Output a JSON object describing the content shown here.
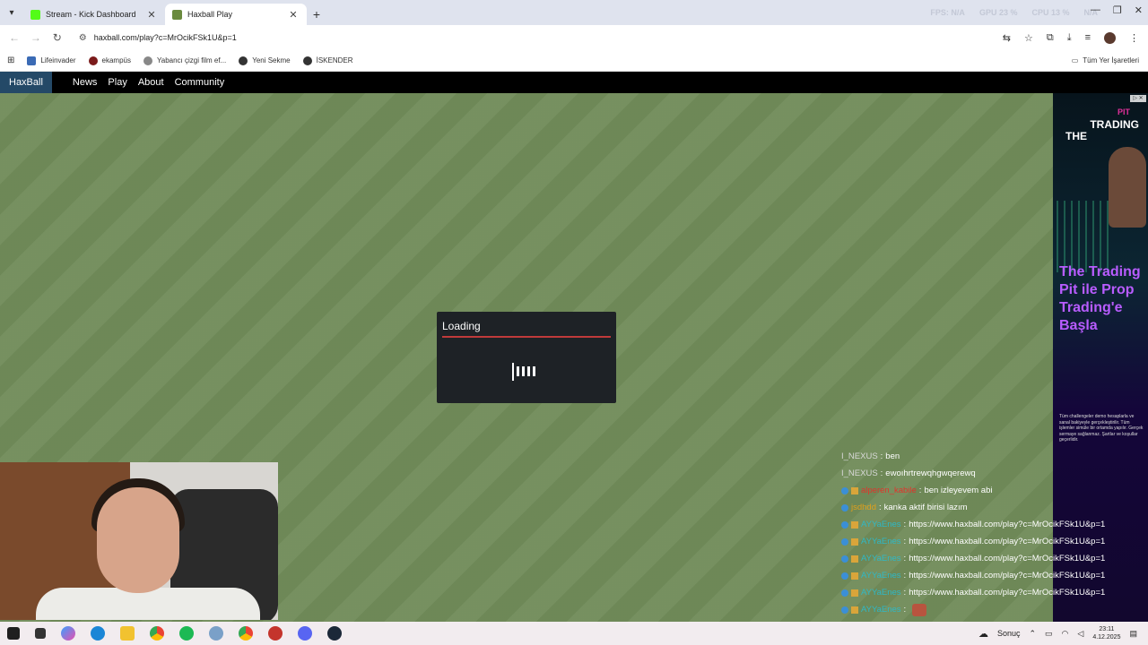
{
  "browser": {
    "tabs": [
      {
        "title": "Stream - Kick Dashboard",
        "fav_color": "#53fc18"
      },
      {
        "title": "Haxball Play",
        "fav_color": "#6a8a3e"
      }
    ],
    "url": "haxball.com/play?c=MrOcikFSk1U&p=1",
    "stats": [
      "FPS: N/A",
      "GPU 23 %",
      "CPU 13 %",
      "N/A"
    ],
    "bookmarks": [
      "Lifeinvader",
      "ekampüs",
      "Yabancı çizgi film ef...",
      "Yeni Sekme",
      "İSKENDER"
    ],
    "all_bookmarks": "Tüm Yer İşaretleri"
  },
  "haxball": {
    "logo": "HaxBall",
    "nav": [
      "News",
      "Play",
      "About",
      "Community"
    ],
    "loading_title": "Loading"
  },
  "ad": {
    "pit": "PIT",
    "trading": "TRADING",
    "the": "THE",
    "headline": "The Trading Pit ile Prop Trading'e Başla",
    "fineprint": "Tüm challengeler demo hesaplarla ve sanal bakiyeyle gerçekleştirilir. Tüm işlemler simüle bir ortamda yapılır. Gerçek sermaye sağlanmaz. Şartlar ve koşullar geçerlidir."
  },
  "chat": [
    {
      "user": "I_NEXUS",
      "user_color": "#d8d8d8",
      "msg": "ben",
      "badges": 0
    },
    {
      "user": "I_NEXUS",
      "user_color": "#d8d8d8",
      "msg": "ewoıhrtrewqhgwqerewq",
      "badges": 0
    },
    {
      "user": "alperen_kabile",
      "user_color": "#e0342c",
      "msg": "ben izleyevem abi",
      "badges": 2
    },
    {
      "user": "jsdhdd",
      "user_color": "#e0a01c",
      "msg": "kanka aktif birisi lazım",
      "badges": 1
    },
    {
      "user": "AYYaEnes",
      "user_color": "#2fb8c6",
      "msg": "https://www.haxball.com/play?c=MrOcikFSk1U&p=1",
      "badges": 2
    },
    {
      "user": "AYYaEnes",
      "user_color": "#2fb8c6",
      "msg": "https://www.haxball.com/play?c=MrOcikFSk1U&p=1",
      "badges": 2
    },
    {
      "user": "AYYaEnes",
      "user_color": "#2fb8c6",
      "msg": "https://www.haxball.com/play?c=MrOcikFSk1U&p=1",
      "badges": 2
    },
    {
      "user": "AYYaEnes",
      "user_color": "#2fb8c6",
      "msg": "https://www.haxball.com/play?c=MrOcikFSk1U&p=1",
      "badges": 2
    },
    {
      "user": "AYYaEnes",
      "user_color": "#2fb8c6",
      "msg": "https://www.haxball.com/play?c=MrOcikFSk1U&p=1",
      "badges": 2
    },
    {
      "user": "AYYaEnes",
      "user_color": "#2fb8c6",
      "msg": "",
      "badges": 2
    }
  ],
  "taskbar": {
    "weather": "Sonuç",
    "time": "23:11",
    "date": "4.12.2025",
    "app_icons": [
      "task-view-icon",
      "copilot-icon",
      "edge-icon",
      "file-explorer-icon",
      "chrome-icon",
      "spotify-icon",
      "settings-icon",
      "chrome-icon",
      "app-icon",
      "discord-icon",
      "steam-icon"
    ]
  }
}
